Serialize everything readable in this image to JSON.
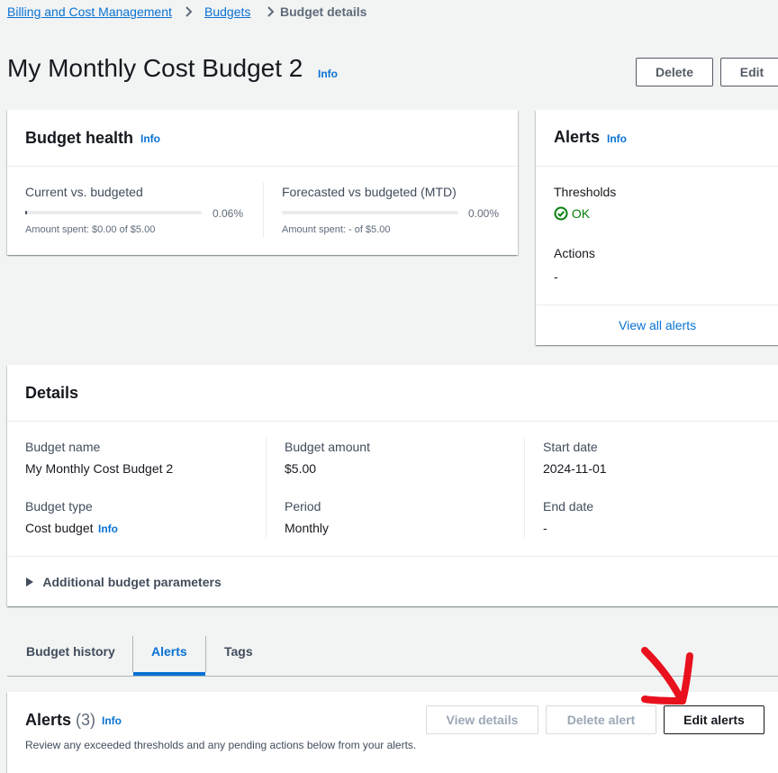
{
  "breadcrumb": {
    "items": [
      "Billing and Cost Management",
      "Budgets"
    ],
    "current": "Budget details"
  },
  "page": {
    "title": "My Monthly Cost Budget 2",
    "info": "Info",
    "delete_label": "Delete",
    "edit_label": "Edit"
  },
  "budget_health": {
    "title": "Budget health",
    "info": "Info",
    "current": {
      "label": "Current vs. budgeted",
      "percent": "0.06%",
      "percent_value": 0.06,
      "caption": "Amount spent: $0.00 of $5.00"
    },
    "forecast": {
      "label": "Forecasted vs budgeted (MTD)",
      "percent": "0.00%",
      "percent_value": 0,
      "caption": "Amount spent: - of $5.00"
    }
  },
  "alerts_card": {
    "title": "Alerts",
    "info": "Info",
    "thresholds_label": "Thresholds",
    "thresholds_status": "OK",
    "actions_label": "Actions",
    "actions_value": "-",
    "view_all": "View all alerts"
  },
  "details": {
    "title": "Details",
    "budget_name_label": "Budget name",
    "budget_name": "My Monthly Cost Budget 2",
    "budget_type_label": "Budget type",
    "budget_type": "Cost budget",
    "budget_type_info": "Info",
    "budget_amount_label": "Budget amount",
    "budget_amount": "$5.00",
    "period_label": "Period",
    "period": "Monthly",
    "start_date_label": "Start date",
    "start_date": "2024-11-01",
    "end_date_label": "End date",
    "end_date": "-",
    "additional": "Additional budget parameters"
  },
  "tabs": {
    "items": [
      "Budget history",
      "Alerts",
      "Tags"
    ],
    "active": "Alerts"
  },
  "alerts_section": {
    "title": "Alerts",
    "count": "(3)",
    "info": "Info",
    "description": "Review any exceeded thresholds and any pending actions below from your alerts.",
    "view_details": "View details",
    "delete_alert": "Delete alert",
    "edit_alerts": "Edit alerts"
  },
  "colors": {
    "link": "#0972d3",
    "ok": "#037f0c",
    "annotation": "#e8111d"
  }
}
